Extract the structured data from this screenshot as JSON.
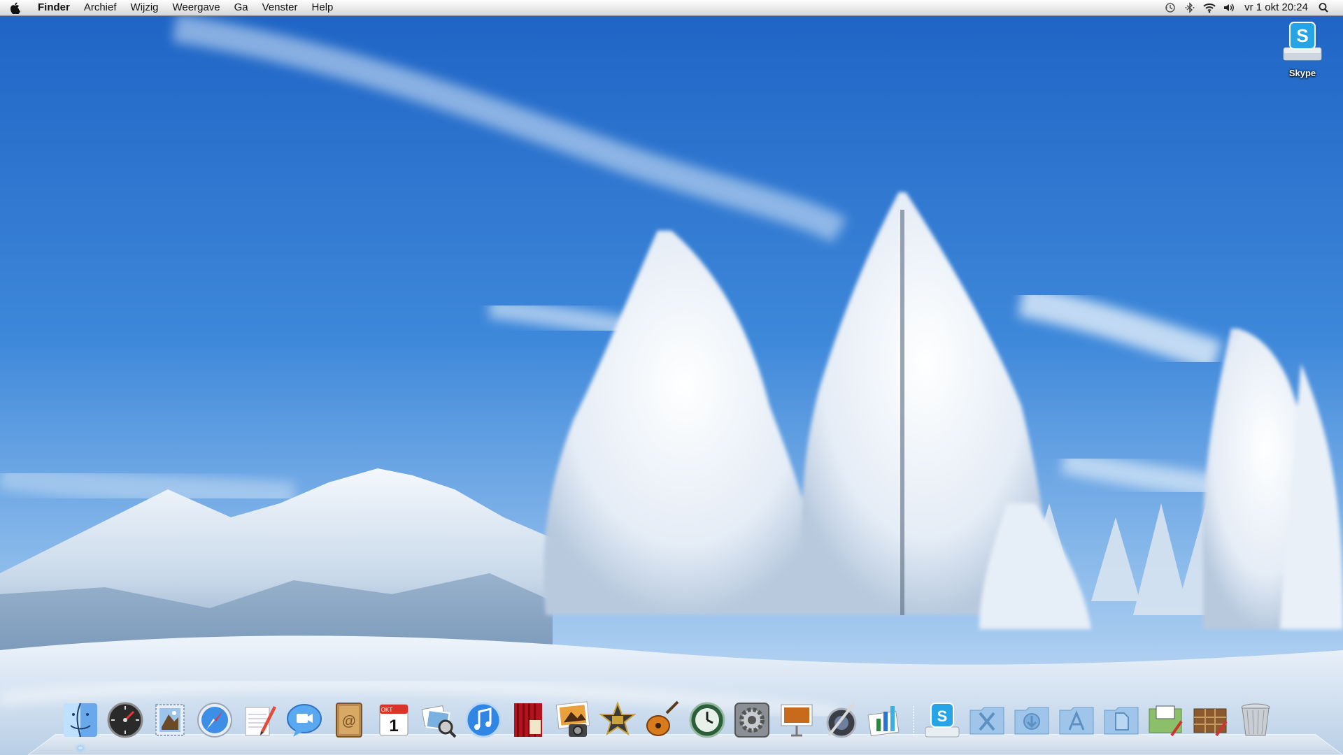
{
  "menubar": {
    "app_name": "Finder",
    "menus": [
      "Archief",
      "Wijzig",
      "Weergave",
      "Ga",
      "Venster",
      "Help"
    ],
    "clock": "vr 1 okt  20:24",
    "status_icons": [
      "time-machine-icon",
      "bluetooth-icon",
      "wifi-icon",
      "volume-icon",
      "spotlight-icon"
    ]
  },
  "desktop": {
    "icons": [
      {
        "label": "Skype",
        "icon": "skype-drive-icon"
      }
    ]
  },
  "dock": {
    "apps": [
      "finder",
      "dashboard",
      "mail",
      "safari",
      "textedit",
      "ichat",
      "address-book",
      "ical",
      "preview",
      "itunes",
      "front-row",
      "iphoto",
      "imovie",
      "garageband",
      "time-machine",
      "system-preferences",
      "keynote",
      "aperture",
      "numbers",
      "skype"
    ],
    "stacks": [
      "utilities",
      "downloads",
      "applications",
      "documents",
      "presentation",
      "photo-stack",
      "trash"
    ],
    "running": [
      "finder"
    ],
    "calendar_month": "OKT",
    "calendar_day": "1"
  },
  "colors": {
    "accent": "#2a74d6",
    "sky_top": "#2f6fc6",
    "sky_bottom": "#a9cdf1",
    "snow": "#eef4fb"
  }
}
